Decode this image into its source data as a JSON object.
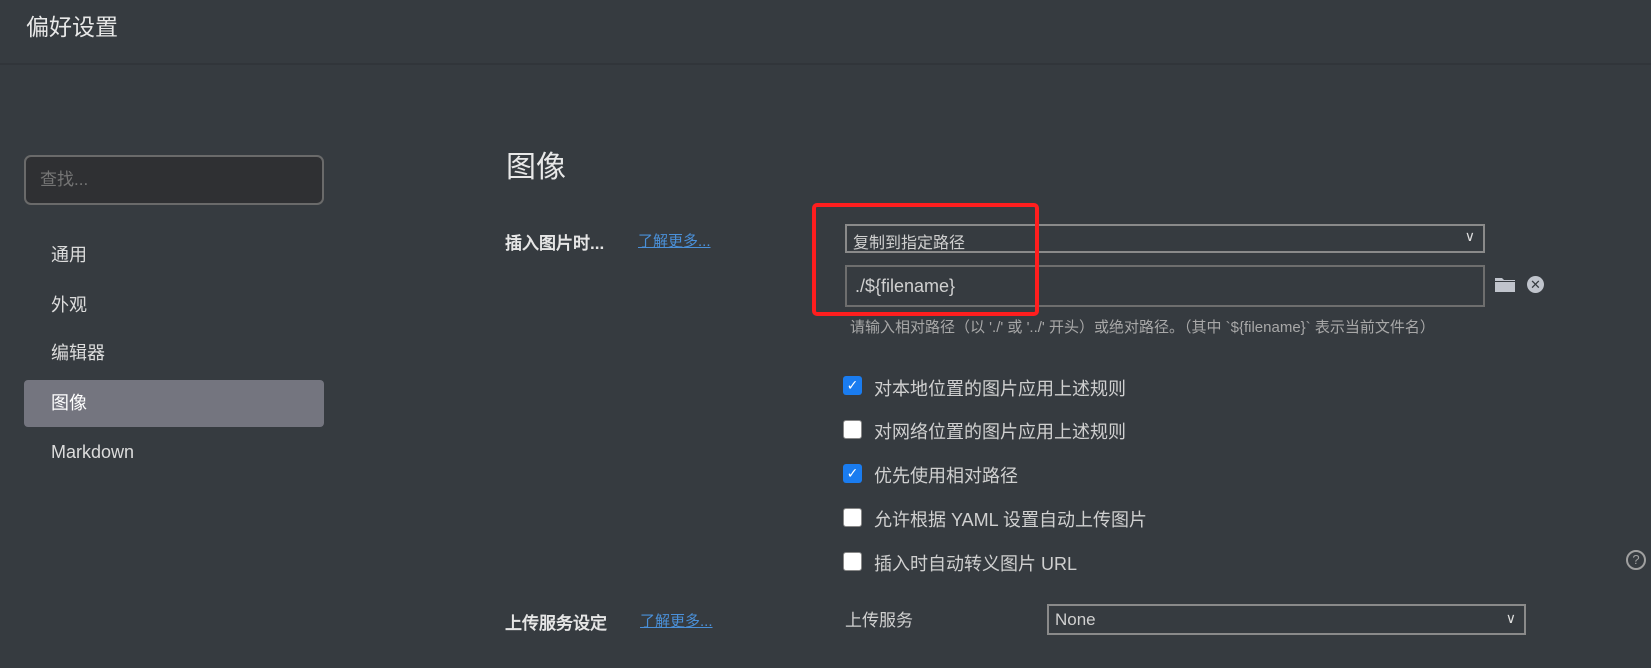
{
  "window": {
    "title": "偏好设置"
  },
  "sidebar": {
    "search_placeholder": "查找...",
    "items": [
      {
        "label": "通用",
        "selected": false
      },
      {
        "label": "外观",
        "selected": false
      },
      {
        "label": "编辑器",
        "selected": false
      },
      {
        "label": "图像",
        "selected": true
      },
      {
        "label": "Markdown",
        "selected": false
      }
    ]
  },
  "main": {
    "heading": "图像",
    "insert_image": {
      "label": "插入图片时...",
      "learn_more": "了解更多...",
      "action_selected": "复制到指定路径",
      "path_value": "./${filename}",
      "hint": "请输入相对路径（以 './' 或 '../' 开头）或绝对路径。（其中 `${filename}` 表示当前文件名）",
      "folder_icon": "folder-icon",
      "clear_icon": "clear-circle-icon"
    },
    "options": [
      {
        "label": "对本地位置的图片应用上述规则",
        "checked": true
      },
      {
        "label": "对网络位置的图片应用上述规则",
        "checked": false
      },
      {
        "label": "优先使用相对路径",
        "checked": true
      },
      {
        "label": "允许根据 YAML 设置自动上传图片",
        "checked": false
      },
      {
        "label": "插入时自动转义图片 URL",
        "checked": false
      }
    ],
    "help_icon": "?",
    "upload": {
      "label": "上传服务设定",
      "learn_more": "了解更多...",
      "service_label": "上传服务",
      "service_selected": "None"
    }
  },
  "colors": {
    "accent": "#1a7cf0",
    "link": "#4a90d9",
    "highlight_box": "#ff1e1e",
    "background": "#363b40"
  }
}
